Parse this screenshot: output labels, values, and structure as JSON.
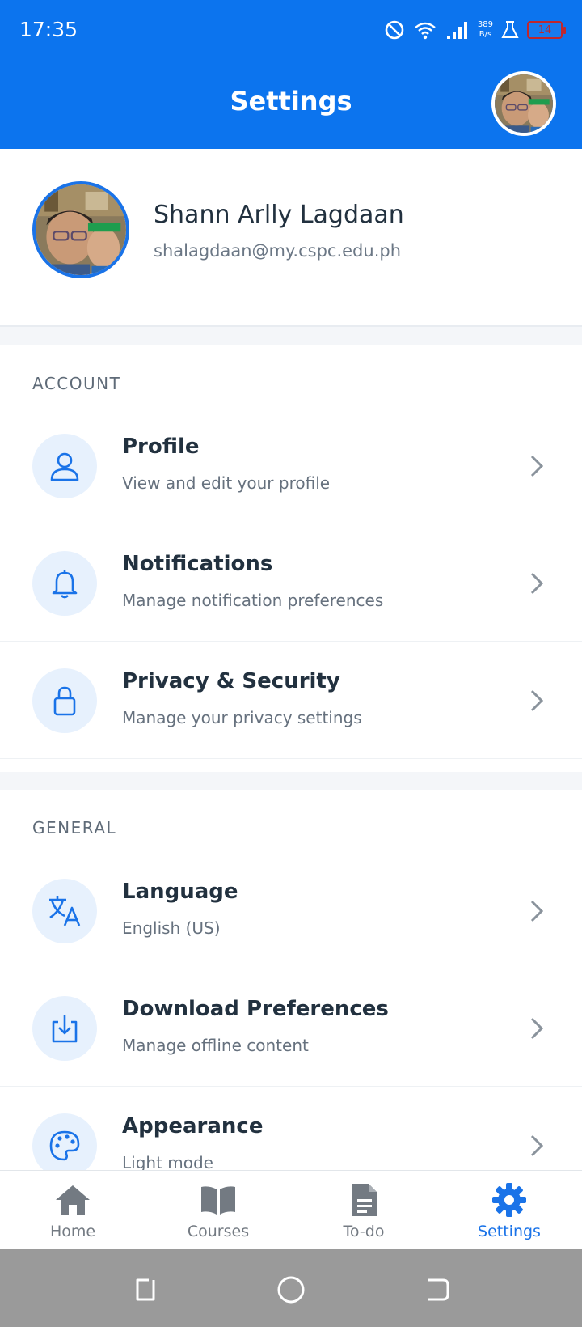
{
  "status_bar": {
    "time": "17:35",
    "net_speed_value": "389",
    "net_speed_unit": "B/s",
    "battery": "14"
  },
  "header": {
    "title": "Settings"
  },
  "profile": {
    "name": "Shann Arlly Lagdaan",
    "email": "shalagdaan@my.cspc.edu.ph"
  },
  "sections": {
    "account": {
      "title": "ACCOUNT",
      "items": [
        {
          "title": "Profile",
          "subtitle": "View and edit your profile",
          "icon": "user-icon"
        },
        {
          "title": "Notifications",
          "subtitle": "Manage notification preferences",
          "icon": "bell-icon"
        },
        {
          "title": "Privacy & Security",
          "subtitle": "Manage your privacy settings",
          "icon": "lock-icon"
        }
      ]
    },
    "general": {
      "title": "GENERAL",
      "items": [
        {
          "title": "Language",
          "subtitle": "English (US)",
          "icon": "translate-icon"
        },
        {
          "title": "Download Preferences",
          "subtitle": "Manage offline content",
          "icon": "download-icon"
        },
        {
          "title": "Appearance",
          "subtitle": "Light mode",
          "icon": "palette-icon"
        }
      ]
    }
  },
  "bottom_nav": {
    "items": [
      {
        "label": "Home",
        "icon": "home-icon",
        "active": false
      },
      {
        "label": "Courses",
        "icon": "book-icon",
        "active": false
      },
      {
        "label": "To-do",
        "icon": "document-icon",
        "active": false
      },
      {
        "label": "Settings",
        "icon": "gear-icon",
        "active": true
      }
    ]
  },
  "colors": {
    "primary": "#0c74ee",
    "accent": "#1a73e8",
    "icon_bg": "#e7f1fd",
    "nav_inactive": "#737a82",
    "system_nav": "#9a9a9a"
  }
}
